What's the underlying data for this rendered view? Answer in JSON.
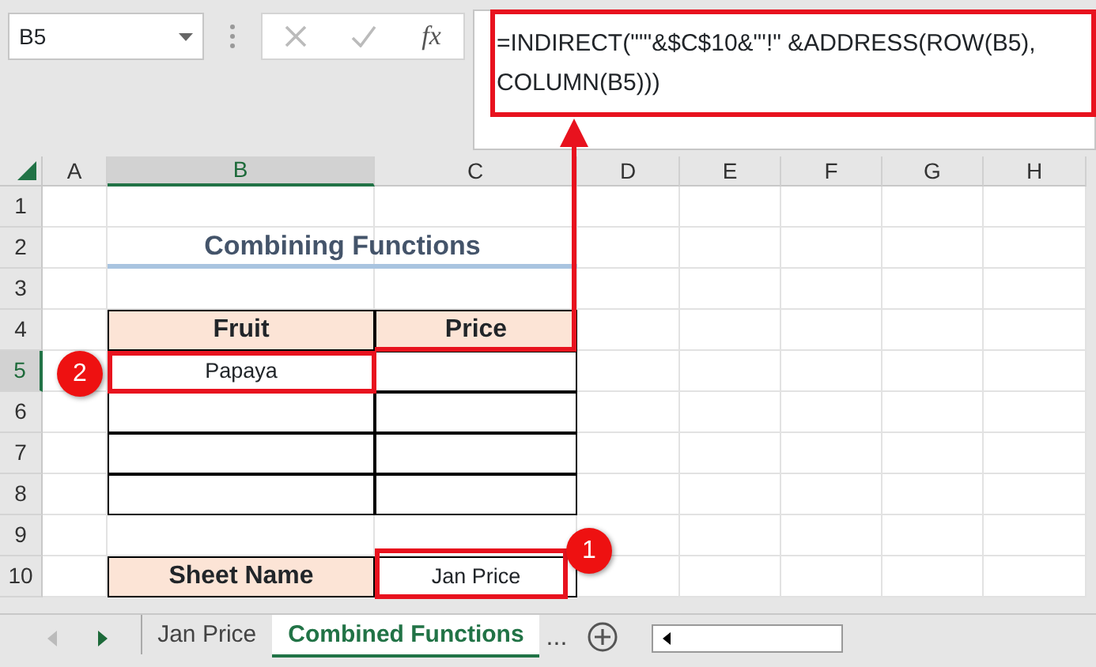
{
  "name_box": {
    "value": "B5"
  },
  "formula_bar": {
    "fx": "fx",
    "formula": "=INDIRECT(\"'\"&$C$10&\"'!\" &ADDRESS(ROW(B5), COLUMN(B5)))"
  },
  "columns": [
    {
      "label": "A",
      "selected": false
    },
    {
      "label": "B",
      "selected": true
    },
    {
      "label": "C",
      "selected": false
    },
    {
      "label": "D",
      "selected": false
    },
    {
      "label": "E",
      "selected": false
    },
    {
      "label": "F",
      "selected": false
    },
    {
      "label": "G",
      "selected": false
    },
    {
      "label": "H",
      "selected": false
    }
  ],
  "rows": [
    {
      "label": "1",
      "selected": false
    },
    {
      "label": "2",
      "selected": false
    },
    {
      "label": "3",
      "selected": false
    },
    {
      "label": "4",
      "selected": false
    },
    {
      "label": "5",
      "selected": true
    },
    {
      "label": "6",
      "selected": false
    },
    {
      "label": "7",
      "selected": false
    },
    {
      "label": "8",
      "selected": false
    },
    {
      "label": "9",
      "selected": false
    },
    {
      "label": "10",
      "selected": false
    }
  ],
  "title": "Combining Functions",
  "fruit_table": {
    "columns": [
      "Fruit",
      "Price"
    ],
    "rows": [
      [
        "Papaya"
      ]
    ]
  },
  "sheet_name": {
    "label": "Sheet Name",
    "value": "Jan Price"
  },
  "callouts": [
    "1",
    "2"
  ],
  "sheet_tabs": [
    {
      "label": "Jan Price",
      "selected": false
    },
    {
      "label": "Combined Functions",
      "selected": true
    }
  ],
  "tab_overflow": "..."
}
